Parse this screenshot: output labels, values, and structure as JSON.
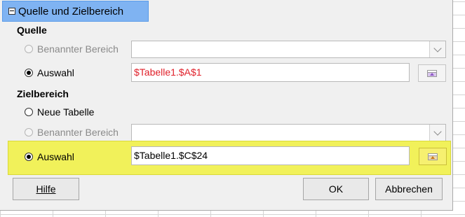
{
  "expander": {
    "label": "Quelle und Zielbereich"
  },
  "source": {
    "title": "Quelle",
    "named_range": {
      "label": "Benannter Bereich",
      "value": ""
    },
    "selection": {
      "label": "Auswahl",
      "value": "$Tabelle1.$A$1"
    }
  },
  "target": {
    "title": "Zielbereich",
    "new_sheet": {
      "label": "Neue Tabelle"
    },
    "named_range": {
      "label": "Benannter Bereich",
      "value": ""
    },
    "selection": {
      "label": "Auswahl",
      "value": "$Tabelle1.$C$24"
    }
  },
  "buttons": {
    "help": "Hilfe",
    "ok": "OK",
    "cancel": "Abbrechen"
  },
  "colors": {
    "source_ref_text": "#e0202a",
    "highlight": "#f1f15a",
    "expander_bg": "#7fb3f2"
  },
  "icons": [
    "expander-minus-icon",
    "shrink-icon",
    "chevron-down-icon"
  ]
}
